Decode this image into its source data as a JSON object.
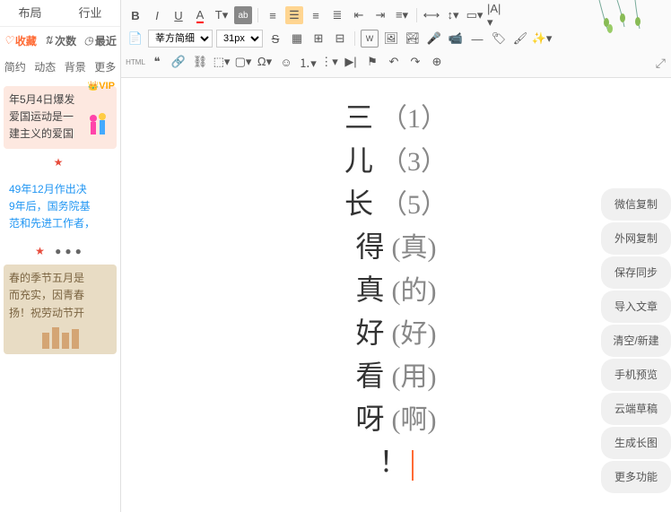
{
  "sidebar": {
    "top_tabs": [
      "布局",
      "行业"
    ],
    "filters": {
      "fav": "收藏",
      "count": "次数",
      "recent": "最近"
    },
    "cats": [
      "简约",
      "动态",
      "背景",
      "更多"
    ],
    "card1": {
      "vip": "VIP",
      "l1": "年5月4日爆发",
      "l2": "爱国运动是一",
      "l3": "建主义的爱国"
    },
    "card2": {
      "l1": "49年12月作出决",
      "l2": "9年后，国务院基",
      "l3": "范和先进工作者，"
    },
    "card3": {
      "l1": "春的季节五月是",
      "l2": "而充实，因青春",
      "l3": "扬！祝劳动节开"
    }
  },
  "toolbar": {
    "font": "莘方简细",
    "size": "31px",
    "html_label": "HTML"
  },
  "editor": {
    "lines": [
      {
        "ch": "三",
        "rt": "（1）"
      },
      {
        "ch": "儿",
        "rt": "（3）"
      },
      {
        "ch": "长",
        "rt": "（5）"
      },
      {
        "ch": "得",
        "rt": "(真)"
      },
      {
        "ch": "真",
        "rt": "(的)"
      },
      {
        "ch": "好",
        "rt": "(好)"
      },
      {
        "ch": "看",
        "rt": "(用)"
      },
      {
        "ch": "呀",
        "rt": "(啊)"
      },
      {
        "ch": "！",
        "rt": ""
      }
    ]
  },
  "rightbar": {
    "items": [
      "微信复制",
      "外网复制",
      "保存同步",
      "导入文章",
      "清空/新建",
      "手机预览",
      "云端草稿",
      "生成长图",
      "更多功能"
    ]
  }
}
